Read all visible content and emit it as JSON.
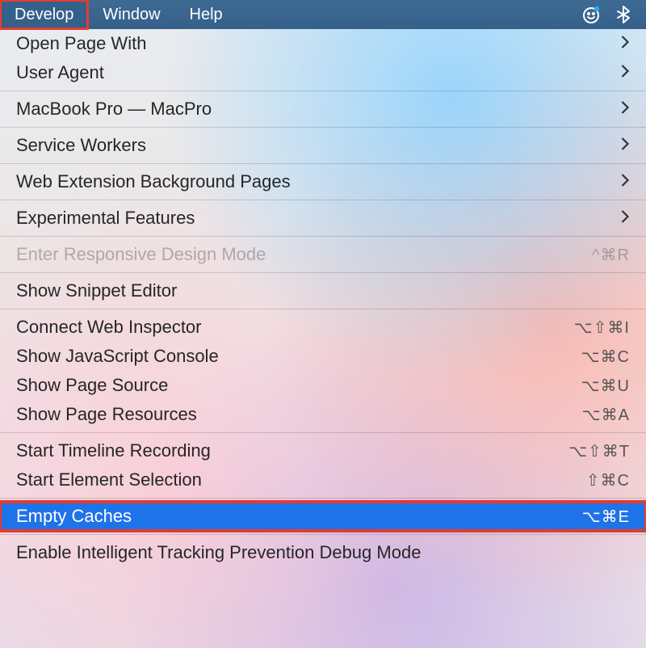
{
  "menubar": {
    "items": [
      "Develop",
      "Window",
      "Help"
    ],
    "highlighted_index": 0,
    "status_icons": [
      "mx-notification-icon",
      "bluetooth-icon"
    ]
  },
  "menu": {
    "groups": [
      [
        {
          "label": "Open Page With",
          "submenu": true
        },
        {
          "label": "User Agent",
          "submenu": true
        }
      ],
      [
        {
          "label": "MacBook Pro — MacPro",
          "submenu": true
        }
      ],
      [
        {
          "label": "Service Workers",
          "submenu": true
        }
      ],
      [
        {
          "label": "Web Extension Background Pages",
          "submenu": true
        }
      ],
      [
        {
          "label": "Experimental Features",
          "submenu": true
        }
      ],
      [
        {
          "label": "Enter Responsive Design Mode",
          "shortcut": "^⌘R",
          "disabled": true
        }
      ],
      [
        {
          "label": "Show Snippet Editor"
        }
      ],
      [
        {
          "label": "Connect Web Inspector",
          "shortcut": "⌥⇧⌘I"
        },
        {
          "label": "Show JavaScript Console",
          "shortcut": "⌥⌘C"
        },
        {
          "label": "Show Page Source",
          "shortcut": "⌥⌘U"
        },
        {
          "label": "Show Page Resources",
          "shortcut": "⌥⌘A"
        }
      ],
      [
        {
          "label": "Start Timeline Recording",
          "shortcut": "⌥⇧⌘T"
        },
        {
          "label": "Start Element Selection",
          "shortcut": "⇧⌘C"
        }
      ],
      [
        {
          "label": "Empty Caches",
          "shortcut": "⌥⌘E",
          "highlight": true
        }
      ],
      [
        {
          "label": "Enable Intelligent Tracking Prevention Debug Mode"
        }
      ]
    ]
  },
  "annotation": {
    "highlight_color": "#e53b2e",
    "selection_color": "#1f73e8"
  }
}
